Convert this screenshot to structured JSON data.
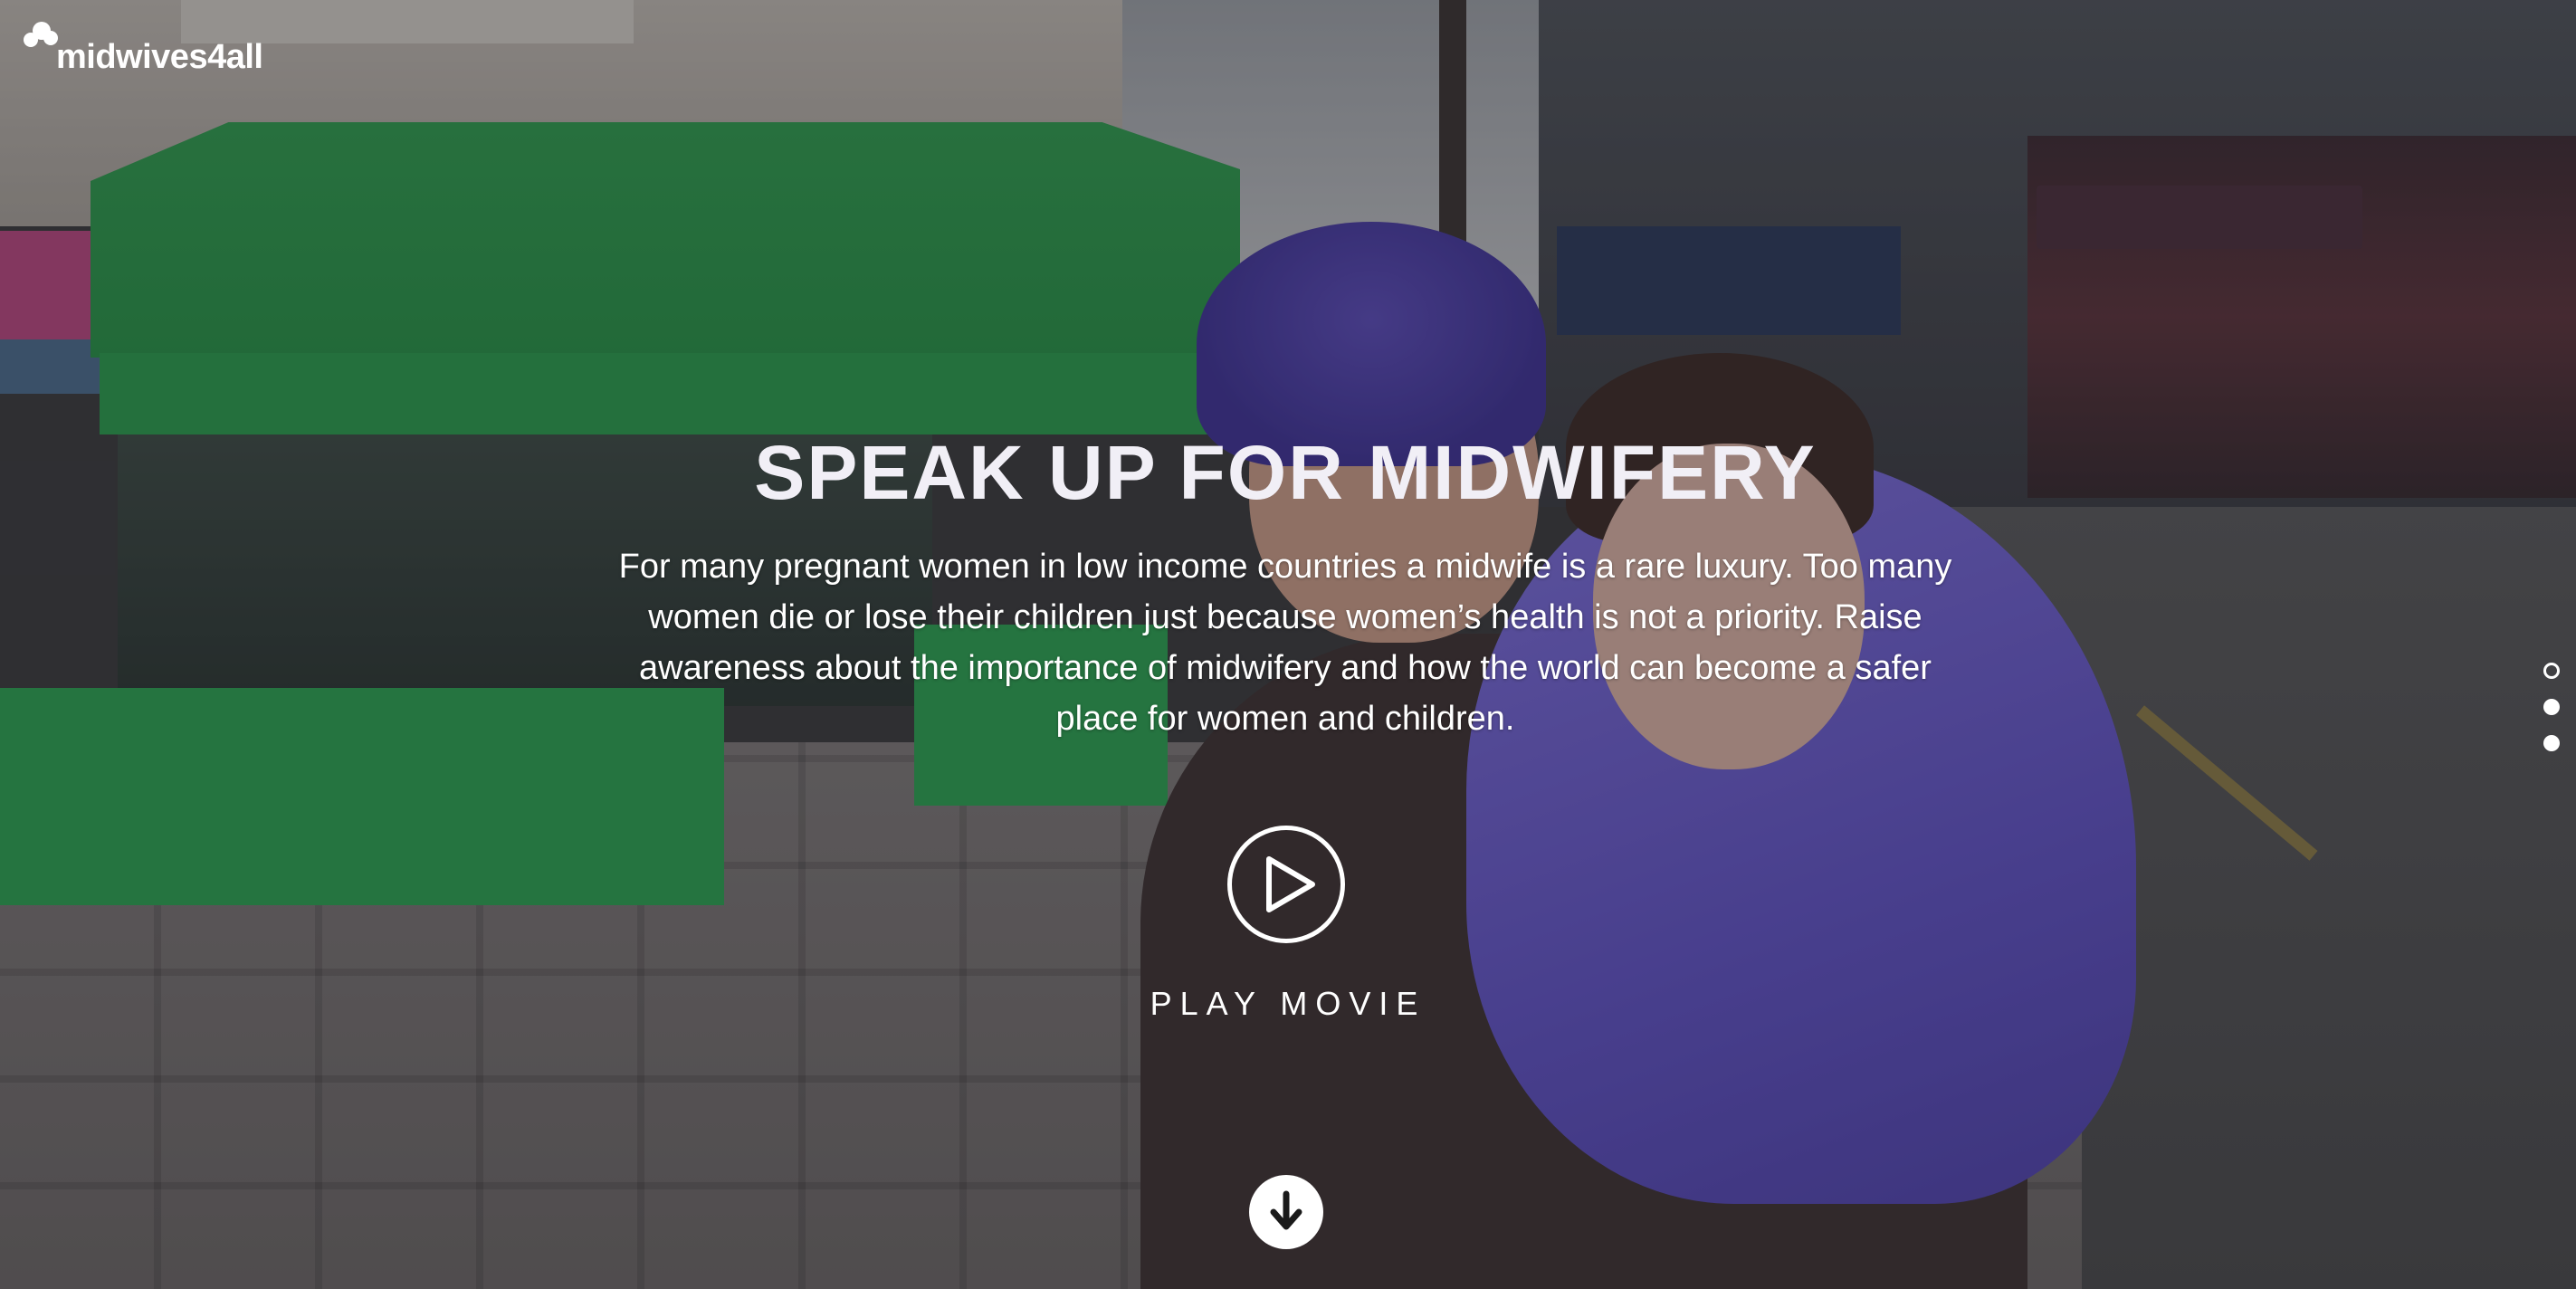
{
  "brand": {
    "logo_text": "midwives4all"
  },
  "hero": {
    "title": "SPEAK UP FOR MIDWIFERY",
    "description": "For many pregnant women in low income countries a midwife is a rare luxury. Too many women die or lose their children just because women’s health is not a priority. Raise awareness about the importance of midwifery and how the world can become a safer place for women and children."
  },
  "play": {
    "icon": "play-icon",
    "label": "PLAY MOVIE"
  },
  "scroll": {
    "icon": "arrow-down-icon"
  },
  "pagination": {
    "total": 3,
    "active_index": 0
  },
  "colors": {
    "tent_green": "#2a9a4a",
    "jacket_purple": "#6a5bcc",
    "text": "#ffffff"
  }
}
